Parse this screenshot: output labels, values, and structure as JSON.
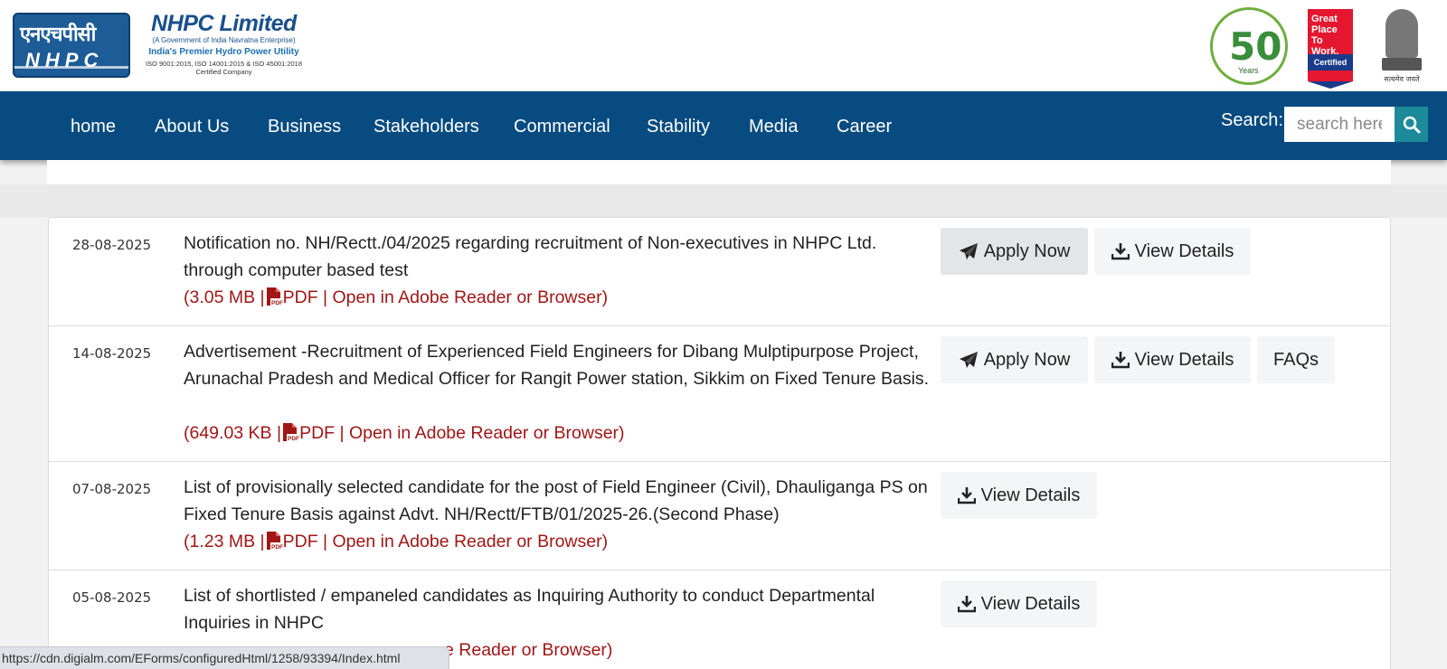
{
  "header": {
    "logo_hindi": "एनएचपीसी",
    "logo_english": "NHPC",
    "company_name": "NHPC Limited",
    "tagline_1": "(A Government of India Navratna Enterprise)",
    "tagline_2": "India's Premier Hydro Power Utility",
    "certifications": "ISO 9001:2015, ISO 14001:2015 & ISO 45001:2018 Certified Company",
    "badge_50_num": "50",
    "badge_50_text": "Years",
    "gptw_text": "Great Place To Work.",
    "gptw_cert": "Certified",
    "emblem_motto": "सत्यमेव जयते"
  },
  "nav": {
    "items": [
      "home",
      "About Us",
      "Business",
      "Stakeholders",
      "Commercial",
      "Stability",
      "Media",
      "Career"
    ],
    "search_label": "Search:",
    "search_placeholder": "search here"
  },
  "notices": [
    {
      "date": "28-08-2025",
      "title": "Notification no. NH/Rectt./04/2025 regarding recruitment of Non-executives in NHPC Ltd. through computer based test",
      "size": "(3.05 MB |",
      "file_suffix": "PDF | Open in Adobe Reader or Browser)",
      "buttons": [
        "Apply Now",
        "View Details"
      ]
    },
    {
      "date": "14-08-2025",
      "title": "Advertisement -Recruitment of Experienced Field Engineers for Dibang Mulptipurpose Project, Arunachal Pradesh and Medical Officer for Rangit Power station, Sikkim on Fixed Tenure Basis.",
      "size": "(649.03 KB |",
      "file_suffix": "PDF | Open in Adobe Reader or Browser)",
      "buttons": [
        "Apply Now",
        "View Details",
        "FAQs"
      ]
    },
    {
      "date": "07-08-2025",
      "title": "List of provisionally selected candidate for the post of Field Engineer (Civil), Dhauliganga PS on Fixed Tenure Basis against Advt. NH/Rectt/FTB/01/2025-26.(Second Phase)",
      "size": "(1.23 MB |",
      "file_suffix": "PDF | Open in Adobe Reader or Browser)",
      "buttons": [
        "View Details"
      ]
    },
    {
      "date": "05-08-2025",
      "title": "List of shortlisted / empaneled candidates as Inquiring Authority to conduct Departmental Inquiries in NHPC",
      "meta_partial": "e Reader or Browser)",
      "buttons": [
        "View Details"
      ]
    }
  ],
  "status_bar": "https://cdn.digialm.com/EForms/configuredHtml/1258/93394/Index.html",
  "colors": {
    "nav_bg": "#074b80",
    "search_button": "#1d8a9a",
    "meta_text": "#a11616"
  }
}
